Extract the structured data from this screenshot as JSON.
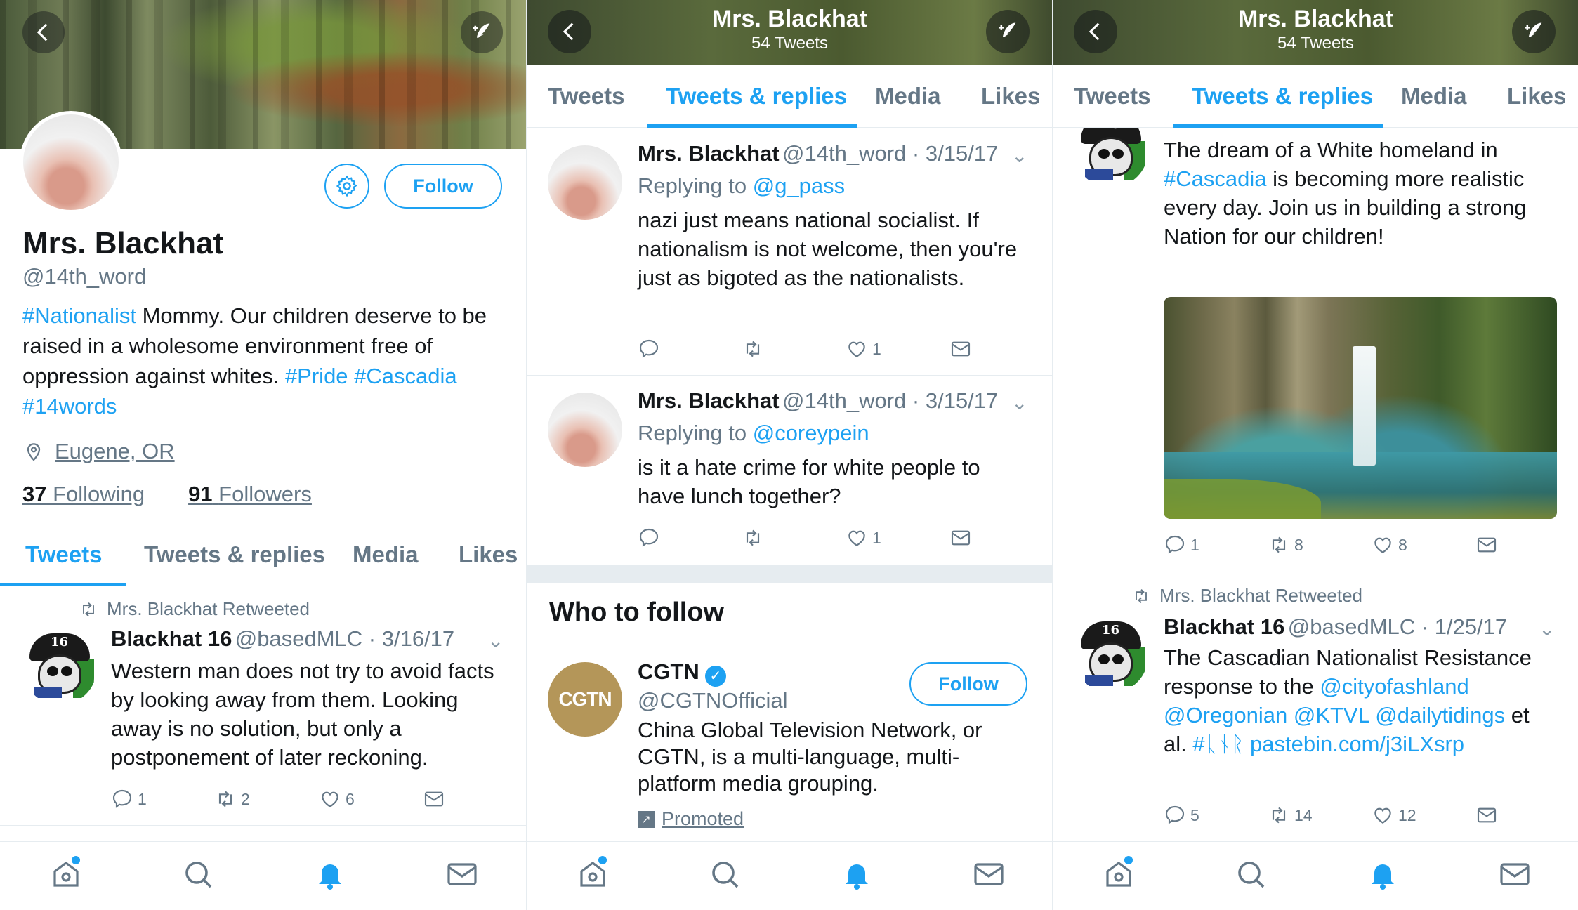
{
  "profile": {
    "name": "Mrs. Blackhat",
    "handle": "@14th_word",
    "follow_label": "Follow",
    "bio_parts": [
      {
        "text": "#Nationalist",
        "link": true
      },
      {
        "text": " Mommy. Our children deserve to be raised in a wholesome environment free of oppression against whites. ",
        "link": false
      },
      {
        "text": "#Pride",
        "link": true
      },
      {
        "text": " ",
        "link": false
      },
      {
        "text": "#Cascadia",
        "link": true
      },
      {
        "text": " ",
        "link": false
      },
      {
        "text": "#14words",
        "link": true
      }
    ],
    "location": "Eugene, OR",
    "following_count": "37",
    "following_label": "Following",
    "followers_count": "91",
    "followers_label": "Followers"
  },
  "header": {
    "title": "Mrs. Blackhat",
    "subtitle": "54 Tweets"
  },
  "tabs": [
    "Tweets",
    "Tweets & replies",
    "Media",
    "Likes"
  ],
  "panel1": {
    "retweet_label": "Mrs. Blackhat Retweeted",
    "tweet": {
      "name": "Blackhat 16",
      "handle": "@basedMLC",
      "date": "3/16/17",
      "text": "Western man does not try to avoid facts by looking away from them. Looking away is no solution, but only a postponement of later reckoning.",
      "replies": "1",
      "retweets": "2",
      "likes": "6"
    }
  },
  "panel2": {
    "tweets": [
      {
        "name": "Mrs. Blackhat",
        "handle": "@14th_word",
        "date": "3/15/17",
        "replying_to": "Replying to",
        "reply_handle": "@g_pass",
        "text": "nazi just means national socialist. If nationalism is not welcome, then you're just as bigoted as the nationalists.",
        "likes": "1"
      },
      {
        "name": "Mrs. Blackhat",
        "handle": "@14th_word",
        "date": "3/15/17",
        "replying_to": "Replying to",
        "reply_handle": "@coreypein",
        "text": "is it a hate crime for white people to have lunch together?",
        "likes": "1"
      }
    ],
    "who_to_follow": "Who to follow",
    "suggestion": {
      "logo_text": "CGTN",
      "name": "CGTN",
      "handle": "@CGTNOfficial",
      "follow_label": "Follow",
      "description": "China Global Television Network, or CGTN, is a multi-language, multi-platform media grouping.",
      "promoted": "Promoted"
    }
  },
  "panel3": {
    "tweet1": {
      "text_parts": [
        {
          "text": "The dream of a White homeland in ",
          "link": false
        },
        {
          "text": "#Cascadia",
          "link": true
        },
        {
          "text": " is becoming more realistic every day. Join us in building a strong Nation for our children!",
          "link": false
        }
      ],
      "replies": "1",
      "retweets": "8",
      "likes": "8"
    },
    "retweet_label": "Mrs. Blackhat Retweeted",
    "tweet2": {
      "name": "Blackhat 16",
      "handle": "@basedMLC",
      "date": "1/25/17",
      "text_parts": [
        {
          "text": "The Cascadian Nationalist Resistance response to the ",
          "link": false
        },
        {
          "text": "@cityofashland @Oregonian @KTVL @dailytidings",
          "link": true
        },
        {
          "text": " et al. ",
          "link": false
        },
        {
          "text": "#ᚳᚾᚱ pastebin.com/j3iLXsrp",
          "link": true
        }
      ],
      "replies": "5",
      "retweets": "14",
      "likes": "12"
    }
  },
  "colors": {
    "accent": "#1da1f2",
    "muted": "#657786",
    "text": "#14171a"
  }
}
